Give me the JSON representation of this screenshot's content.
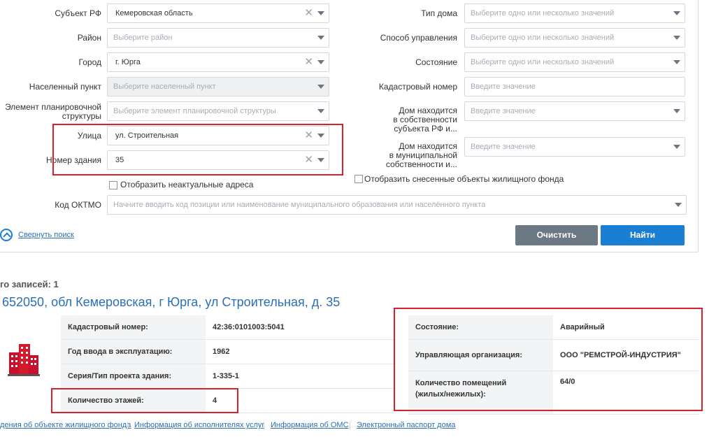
{
  "form": {
    "subject": {
      "label": "Субъект РФ",
      "value": "Кемеровская область"
    },
    "district": {
      "label": "Район",
      "placeholder": "Выберите район"
    },
    "city": {
      "label": "Город",
      "value": "г. Юрга"
    },
    "settlement": {
      "label": "Населенный пункт",
      "placeholder": "Выберите населенный пункт"
    },
    "planning": {
      "label_line1": "Элемент планировочной",
      "label_line2": "структуры",
      "placeholder": "Выберите элемент планировочной структуры"
    },
    "street": {
      "label": "Улица",
      "value": "ул. Строительная"
    },
    "building": {
      "label": "Номер здания",
      "value": "35"
    },
    "house_type": {
      "label": "Тип дома",
      "placeholder": "Выберите одно или несколько значений"
    },
    "management": {
      "label": "Способ управления",
      "placeholder": "Выберите одно или несколько значений"
    },
    "condition": {
      "label": "Состояние",
      "placeholder": "Выберите одно или несколько значений"
    },
    "cadastral": {
      "label": "Кадастровый номер",
      "placeholder": "Введите значение"
    },
    "subject_owned": {
      "label_line1": "Дом находится",
      "label_line2": "в собственности",
      "label_line3": "субъекта РФ и...",
      "placeholder": "Введите значение"
    },
    "municipal_owned": {
      "label_line1": "Дом находится",
      "label_line2": "в муниципальной",
      "label_line3": "собственности и...",
      "placeholder": "Введите значение"
    },
    "show_outdated": "Отобразить неактуальные адреса",
    "show_demolished": "Отобразить снесенные объекты жилищного фонда",
    "oktmo": {
      "label": "Код ОКТМО",
      "placeholder": "Начните вводить код позиции или наименование муниципального образования или населённого пункта"
    },
    "collapse": "Свернуть поиск",
    "clear_btn": "Очистить",
    "find_btn": "Найти"
  },
  "results": {
    "count_label": "го записей: 1",
    "address": "652050, обл Кемеровская, г Юрга, ул Строительная, д. 35",
    "left_rows": [
      {
        "k": "Кадастровый номер:",
        "v": "42:36:0101003:5041"
      },
      {
        "k": "Год ввода в эксплуатацию:",
        "v": "1962"
      },
      {
        "k": "Серия/Тип проекта здания:",
        "v": "1-335-1"
      },
      {
        "k": "Количество этажей:",
        "v": "4"
      }
    ],
    "right_rows": [
      {
        "k": "Состояние:",
        "v": "Аварийный"
      },
      {
        "k": "Управляющая организация:",
        "v": "ООО \"РЕМСТРОЙ-ИНДУСТРИЯ\""
      },
      {
        "k1": "Количество помещений",
        "k2": "(жилых/нежилых):",
        "v": "64/0"
      }
    ],
    "links": [
      "дения об объекте жилищного фонда",
      "Информация об исполнителях услуг",
      "Информация об ОМС",
      "Электронный паспорт дома"
    ]
  },
  "colors": {
    "accent": "#1a7fd3",
    "link": "#2b6fb6",
    "gray_button": "#6c7883",
    "highlight": "#d9202c"
  }
}
